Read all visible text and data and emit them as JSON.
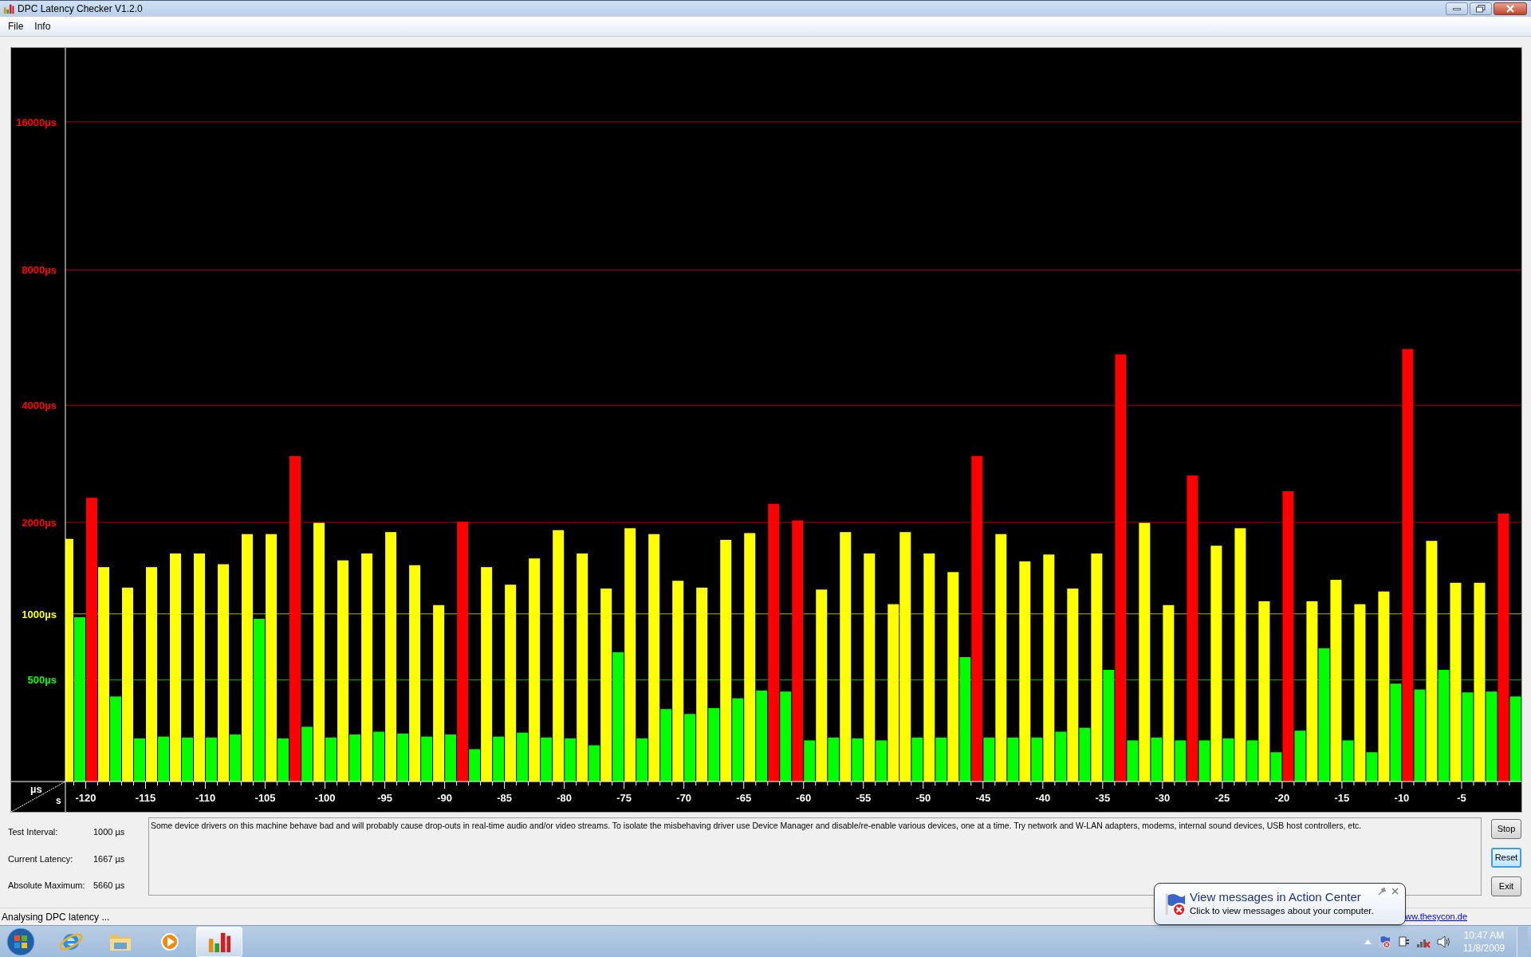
{
  "window": {
    "title": "DPC Latency Checker V1.2.0"
  },
  "menu": [
    "File",
    "Info"
  ],
  "chart": {
    "y_labels": [
      "16000µs",
      "8000µs",
      "4000µs",
      "2000µs",
      "1000µs",
      "500µs"
    ],
    "x_labels": [
      "-120",
      "-115",
      "-110",
      "-105",
      "-100",
      "-95",
      "-90",
      "-85",
      "-80",
      "-75",
      "-70",
      "-65",
      "-60",
      "-55",
      "-50",
      "-45",
      "-40",
      "-35",
      "-30",
      "-25",
      "-20",
      "-15",
      "-10",
      "-5"
    ],
    "y_unit": "µs",
    "x_unit": "s"
  },
  "stats": [
    {
      "label": "Test Interval:",
      "value": "1000 µs"
    },
    {
      "label": "Current Latency:",
      "value": "1667 µs"
    },
    {
      "label": "Absolute Maximum:",
      "value": "5660 µs"
    }
  ],
  "message": "Some device drivers on this machine behave bad and will probably cause drop-outs in real-time audio and/or video streams. To isolate the misbehaving driver use Device Manager and disable/re-enable various devices, one at a time. Try network and W-LAN adapters, modems, internal sound devices, USB host controllers, etc.",
  "buttons": [
    {
      "label": "Stop",
      "focused": false
    },
    {
      "label": "Reset",
      "focused": true
    },
    {
      "label": "Exit",
      "focused": false
    }
  ],
  "status_bar": {
    "text": "Analysing DPC latency ...",
    "link": "ww.thesycon.de"
  },
  "notification": {
    "title": "View messages in Action Center",
    "body": "Click to view messages about your computer."
  },
  "taskbar": {
    "buttons": [
      {
        "selected": false
      },
      {
        "selected": false
      },
      {
        "selected": false
      },
      {
        "selected": true
      }
    ],
    "clock": {
      "time": "10:47 AM",
      "date": "11/8/2009"
    }
  }
}
